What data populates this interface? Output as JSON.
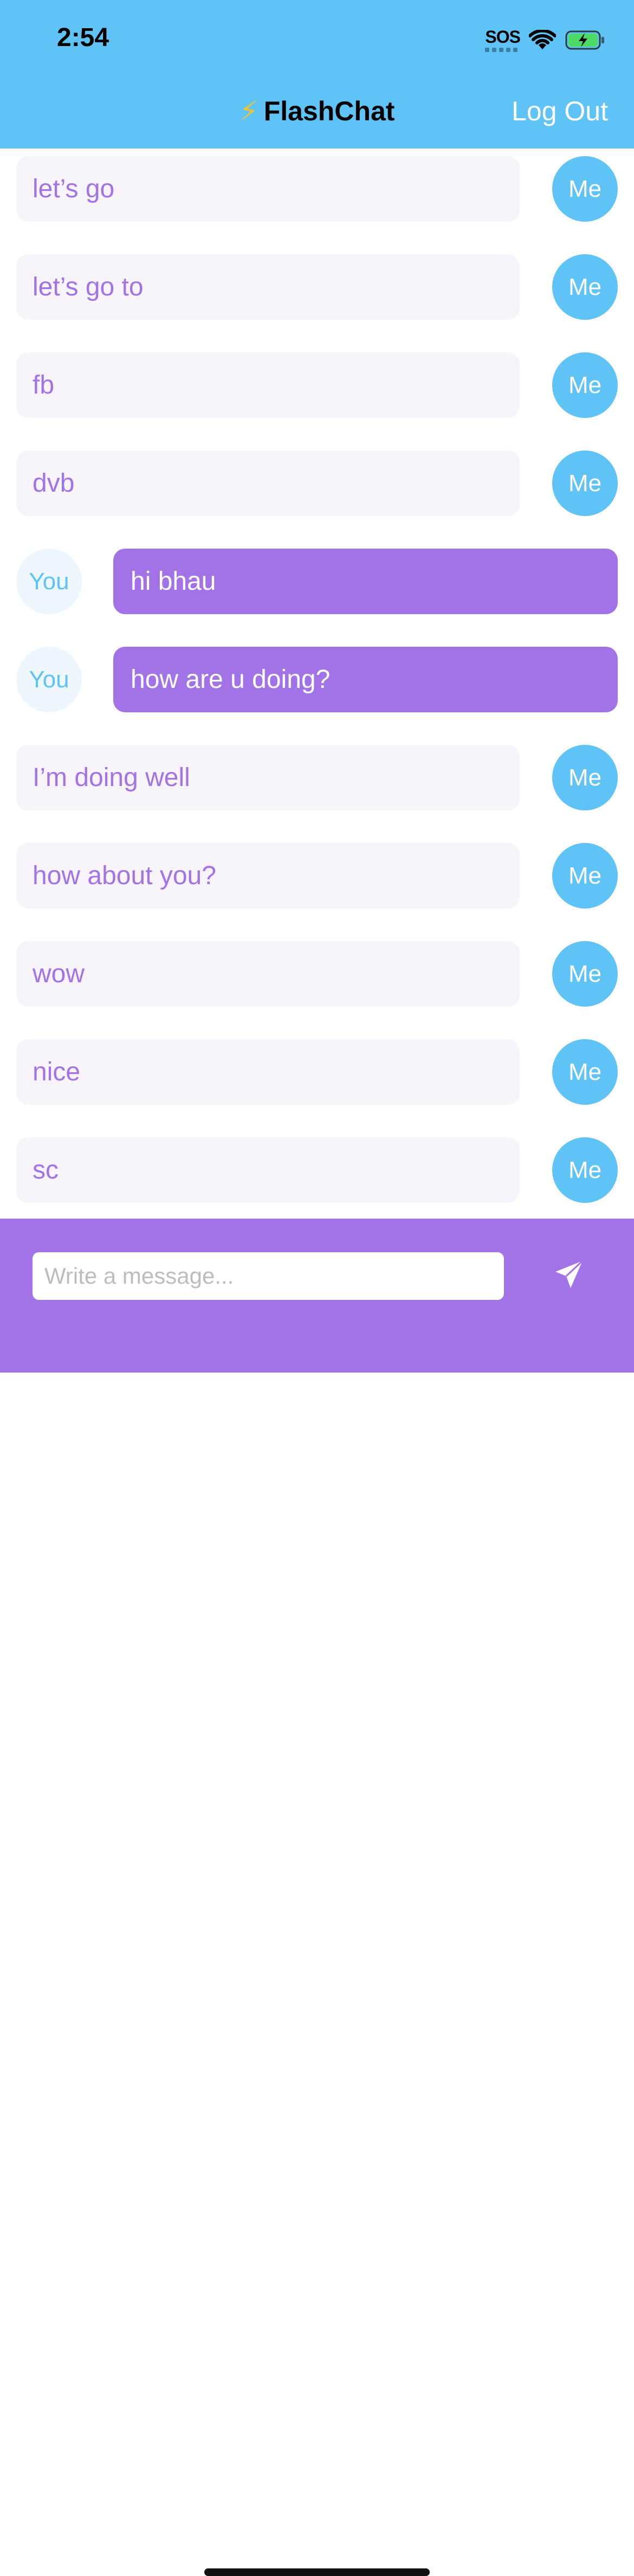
{
  "status_bar": {
    "time": "2:54",
    "sos": "SOS",
    "icons": [
      "sos-satellite-icon",
      "wifi-icon",
      "battery-charging-icon"
    ]
  },
  "nav": {
    "title_icon": "⚡",
    "title": "FlashChat",
    "logout_label": "Log Out"
  },
  "messages": [
    {
      "sender": "me",
      "text": "let’s go",
      "avatar": "Me"
    },
    {
      "sender": "me",
      "text": "let’s go to",
      "avatar": "Me"
    },
    {
      "sender": "me",
      "text": "fb",
      "avatar": "Me"
    },
    {
      "sender": "me",
      "text": "dvb",
      "avatar": "Me"
    },
    {
      "sender": "you",
      "text": "hi bhau",
      "avatar": "You"
    },
    {
      "sender": "you",
      "text": "how are u doing?",
      "avatar": "You"
    },
    {
      "sender": "me",
      "text": "I’m doing well",
      "avatar": "Me"
    },
    {
      "sender": "me",
      "text": "how about you?",
      "avatar": "Me"
    },
    {
      "sender": "me",
      "text": "wow",
      "avatar": "Me"
    },
    {
      "sender": "me",
      "text": "nice",
      "avatar": "Me"
    },
    {
      "sender": "me",
      "text": "sc",
      "avatar": "Me"
    }
  ],
  "composer": {
    "value": "",
    "placeholder": "Write a message...",
    "send_icon": "paper-plane-icon"
  },
  "colors": {
    "nav_blue": "#5FC3F6",
    "brand_purple": "#A273E6",
    "me_bubble": "#F7F4FC",
    "you_avatar_bg": "#EEF7FE"
  }
}
